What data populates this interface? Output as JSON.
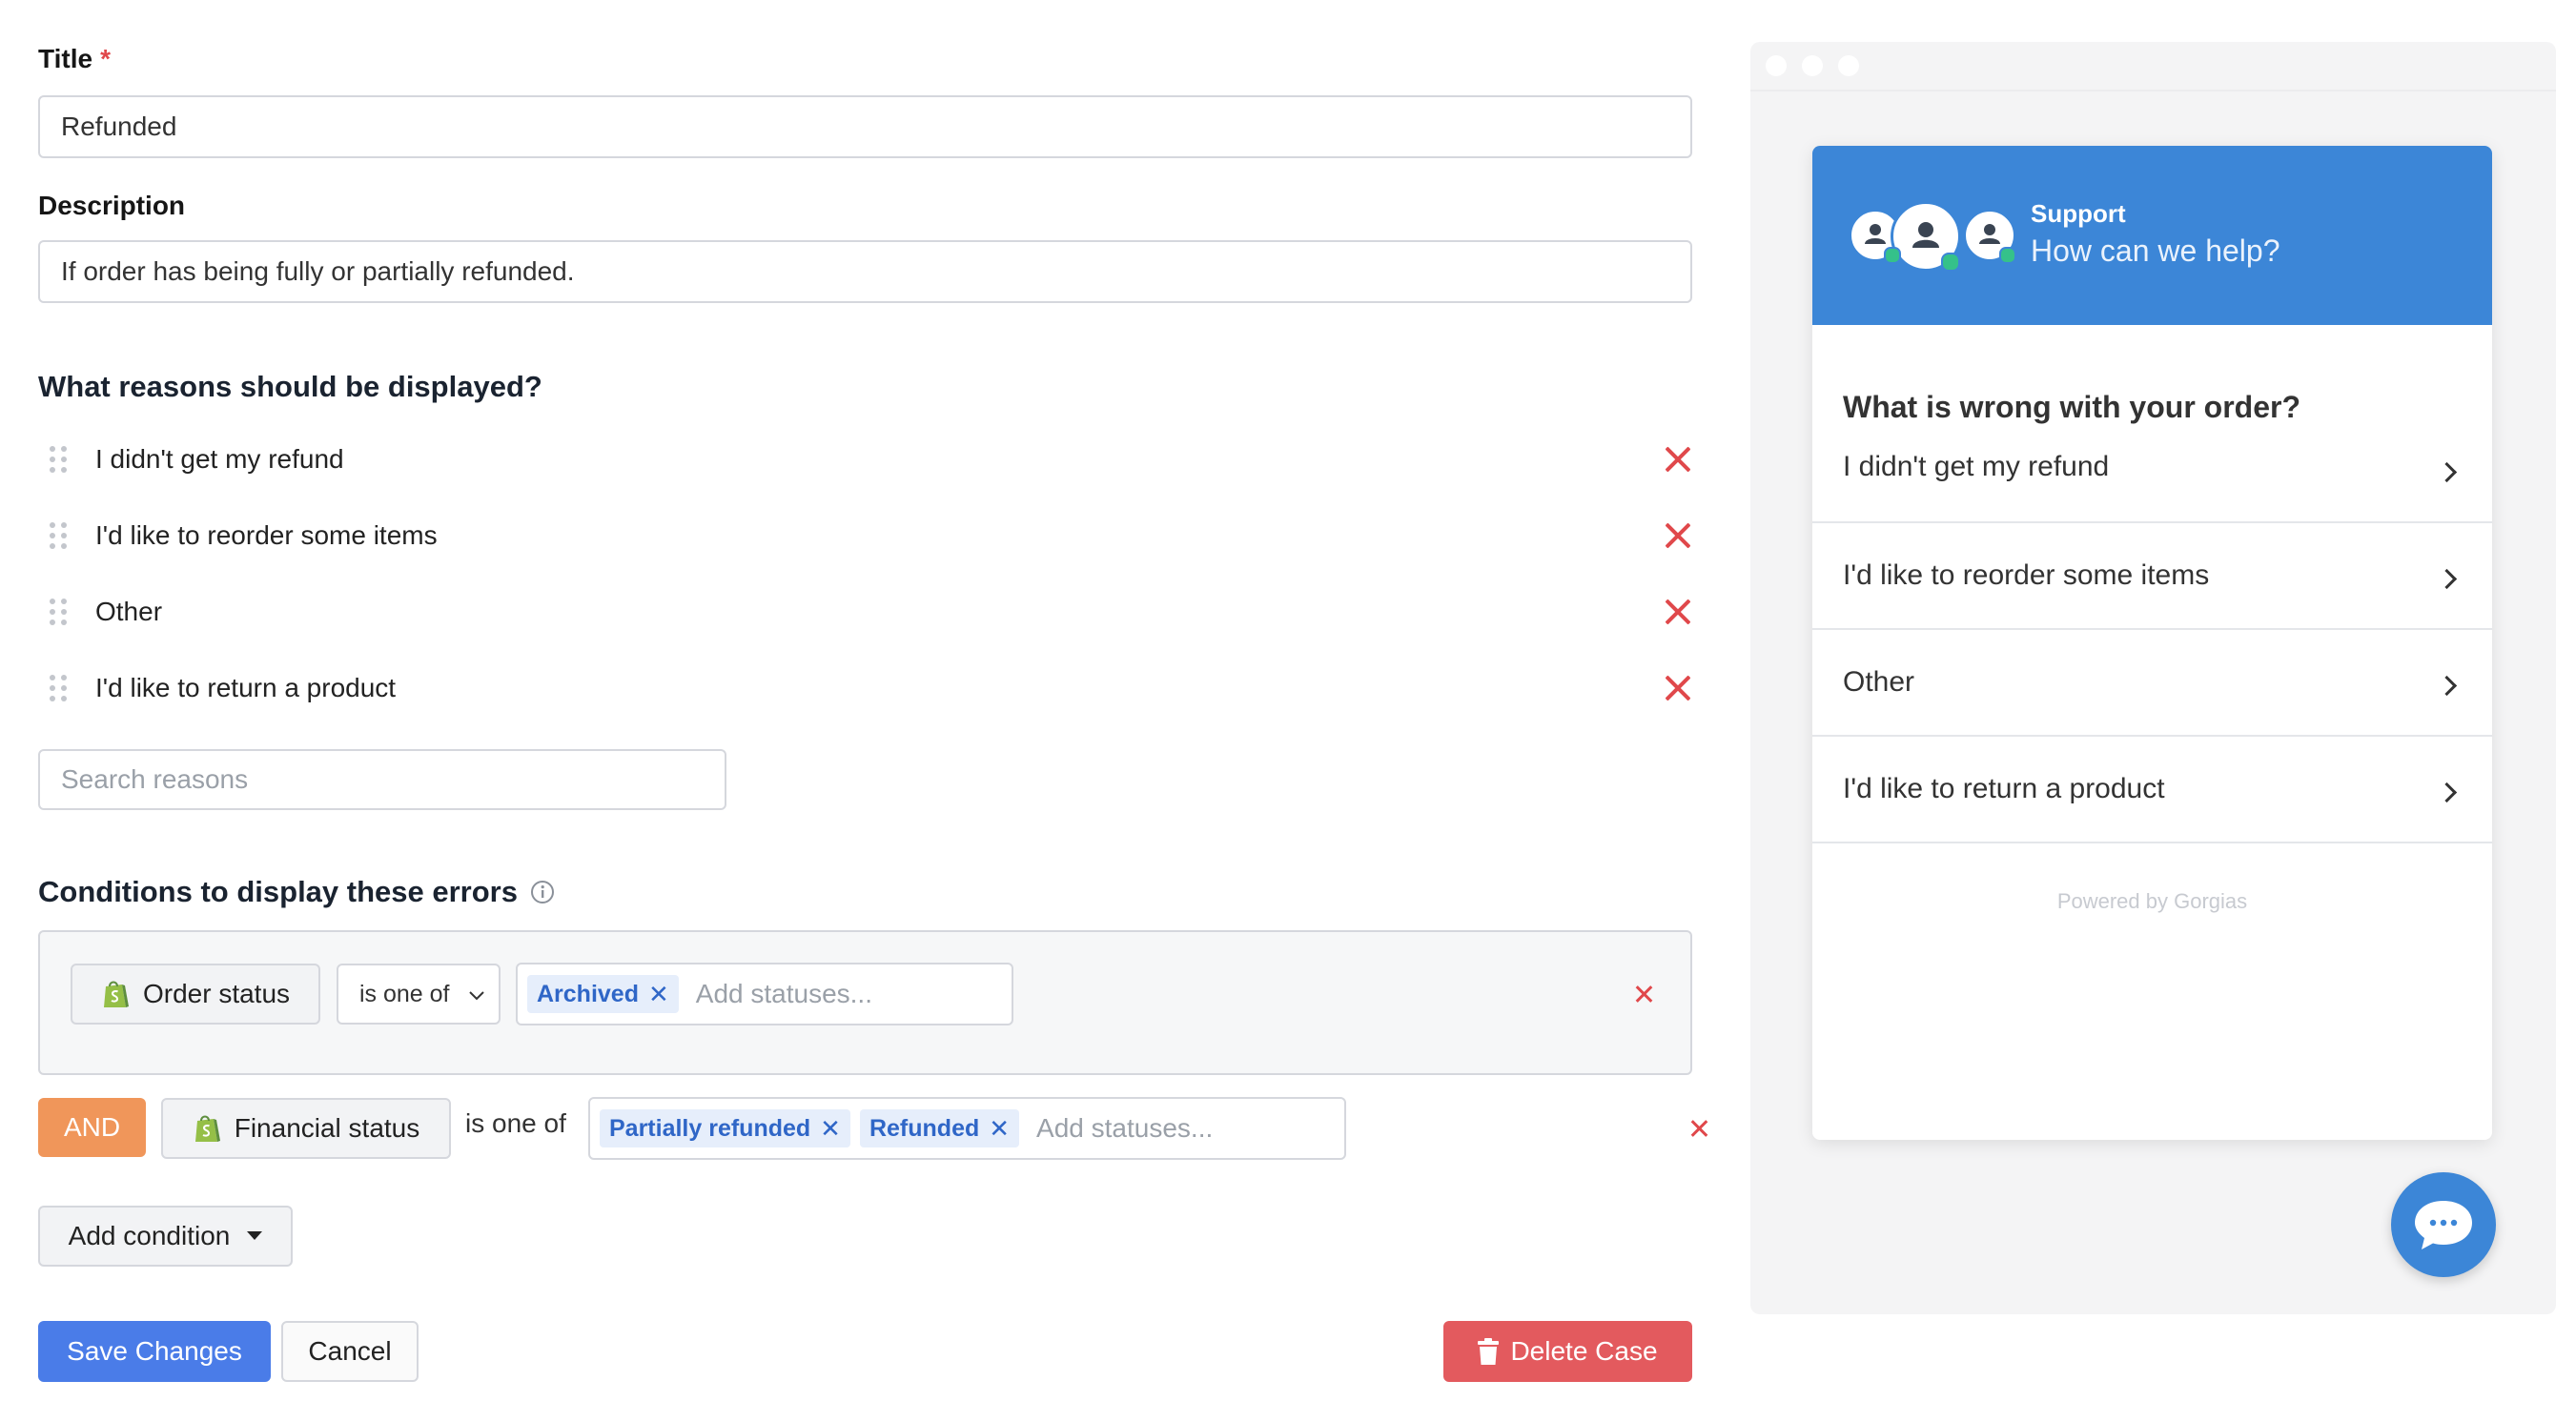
{
  "form": {
    "title_label": "Title",
    "required_mark": "*",
    "title_value": "Refunded",
    "description_label": "Description",
    "description_value": "If order has being fully or partially refunded.",
    "reasons_heading": "What reasons should be displayed?",
    "reasons": [
      {
        "label": "I didn't get my refund"
      },
      {
        "label": "I'd like to reorder some items"
      },
      {
        "label": "Other"
      },
      {
        "label": "I'd like to return a product"
      }
    ],
    "search_placeholder": "Search reasons",
    "conditions_heading": "Conditions to display these errors",
    "condition1": {
      "field": "Order status",
      "operator": "is one of",
      "tags": [
        "Archived"
      ],
      "placeholder": "Add statuses..."
    },
    "condition2": {
      "joiner": "AND",
      "field": "Financial status",
      "operator": "is one of",
      "tags": [
        "Partially refunded",
        "Refunded"
      ],
      "placeholder": "Add statuses..."
    },
    "add_condition": "Add condition",
    "save": "Save Changes",
    "cancel": "Cancel",
    "delete": "Delete Case"
  },
  "preview": {
    "header_title": "Support",
    "header_subtitle": "How can we help?",
    "question": "What is wrong with your order?",
    "options": [
      {
        "label": "I didn't get my refund"
      },
      {
        "label": "I'd like to reorder some items"
      },
      {
        "label": "Other"
      },
      {
        "label": "I'd like to return a product"
      }
    ],
    "powered_by": "Powered by Gorgias"
  },
  "colors": {
    "primary": "#4a7ce8",
    "danger": "#e0484b",
    "and_badge": "#f0965a",
    "header_blue": "#3c86d7",
    "tag_bg": "#e6eefb",
    "tag_text": "#2f66c7"
  }
}
